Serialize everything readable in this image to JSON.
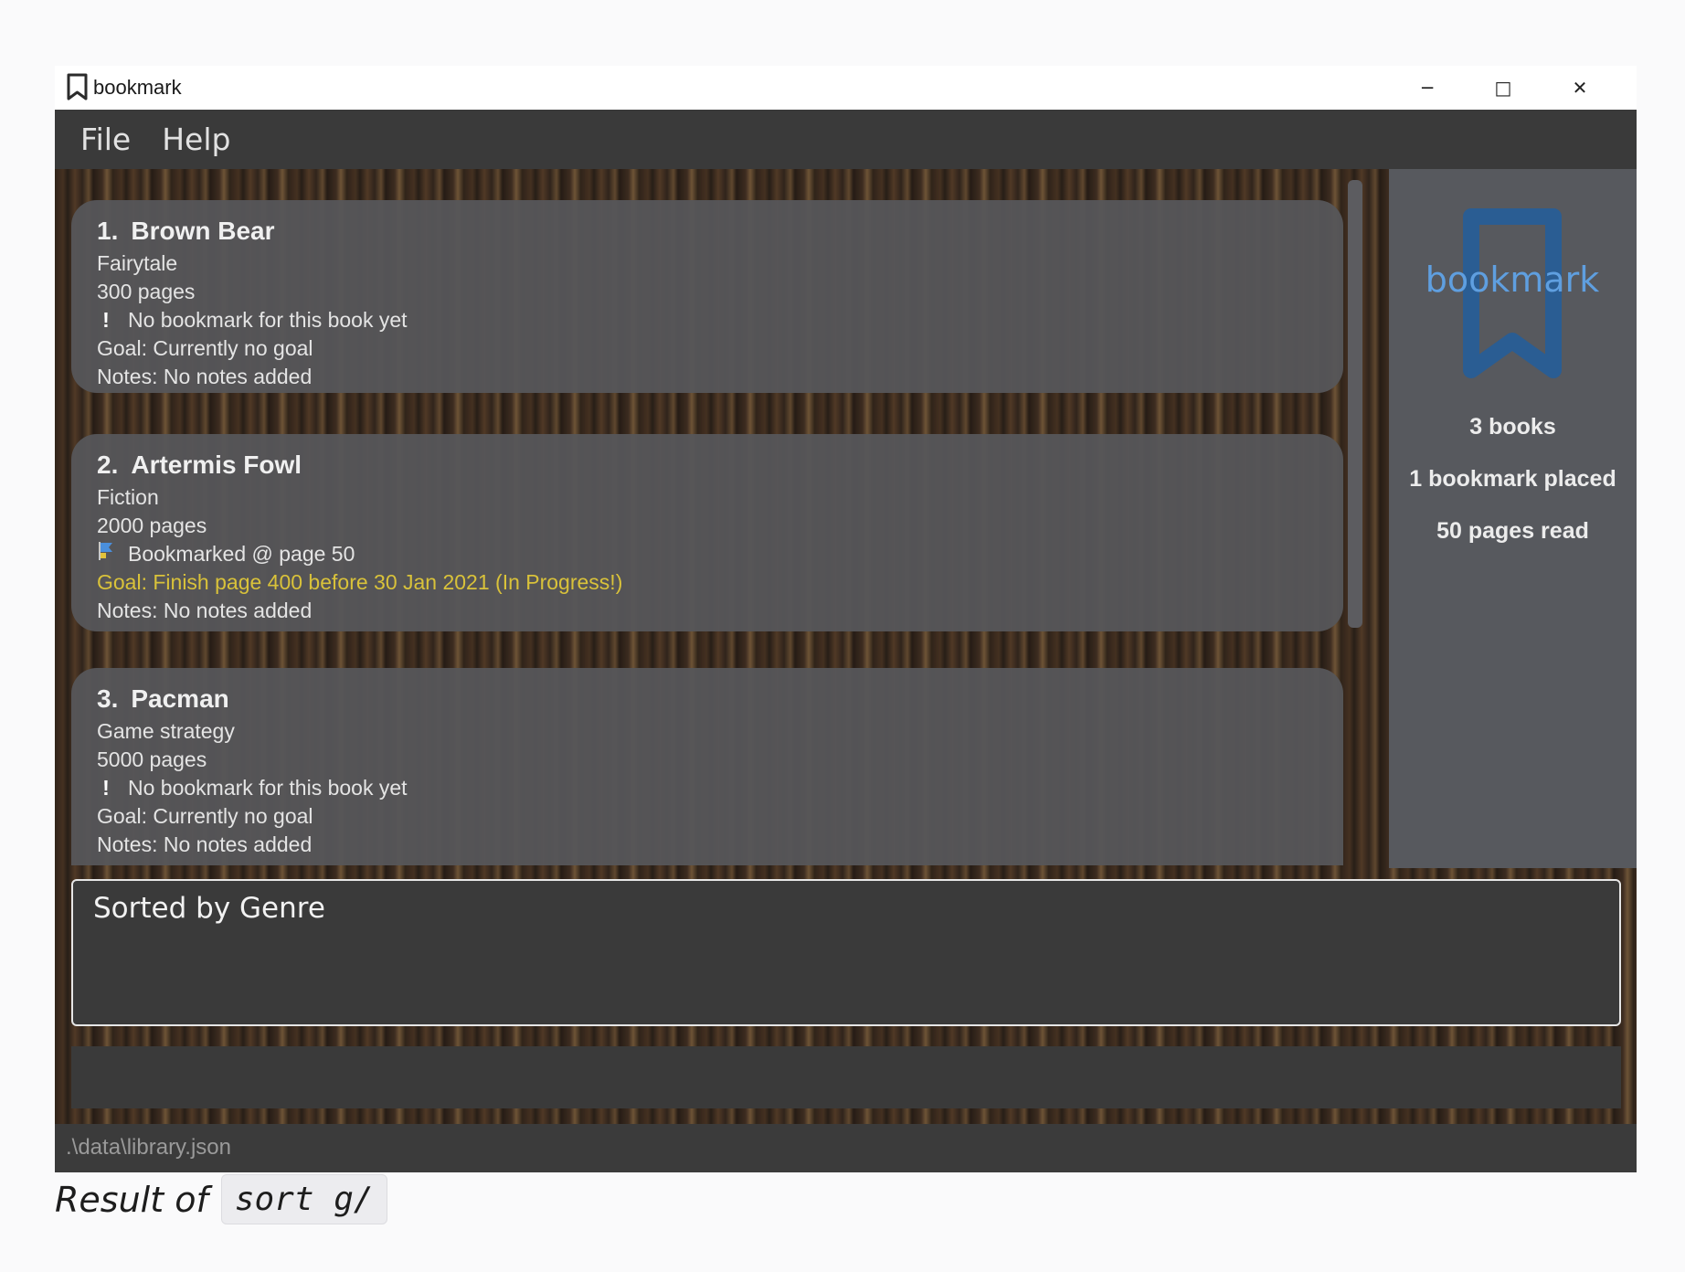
{
  "window": {
    "title": "bookmark",
    "minimize": "─",
    "maximize": "□",
    "close": "✕"
  },
  "menu": [
    "File",
    "Help"
  ],
  "books": [
    {
      "index": "1.",
      "title": "Brown Bear",
      "genre": "Fairytale",
      "pages": "300 pages",
      "bookmark_icon": "exclamation-icon",
      "bookmark": "No bookmark for this book yet",
      "goal": "Goal: Currently no goal",
      "goal_active": false,
      "notes": "Notes: No notes added"
    },
    {
      "index": "2.",
      "title": "Artermis Fowl",
      "genre": "Fiction",
      "pages": "2000 pages",
      "bookmark_icon": "bookmark-flag-icon",
      "bookmark": "Bookmarked @ page 50",
      "goal": "Goal: Finish page 400 before 30 Jan 2021 (In Progress!)",
      "goal_active": true,
      "notes": "Notes: No notes added"
    },
    {
      "index": "3.",
      "title": "Pacman",
      "genre": "Game strategy",
      "pages": "5000 pages",
      "bookmark_icon": "exclamation-icon",
      "bookmark": "No bookmark for this book yet",
      "goal": "Goal: Currently no goal",
      "goal_active": false,
      "notes": "Notes: No notes added"
    }
  ],
  "stats": {
    "logo_text": "bookmark",
    "books": "3 books",
    "bookmarks": "1 bookmark placed",
    "pages_read": "50 pages read"
  },
  "result": "Sorted by Genre",
  "command": {
    "value": ""
  },
  "status_bar": ".\\data\\library.json",
  "caption": {
    "text": "Result of",
    "code": "sort g/"
  },
  "colors": {
    "goal_active": "#d9c23a",
    "logo_blue": "#2a5d93",
    "card_bg": "#56565a"
  }
}
